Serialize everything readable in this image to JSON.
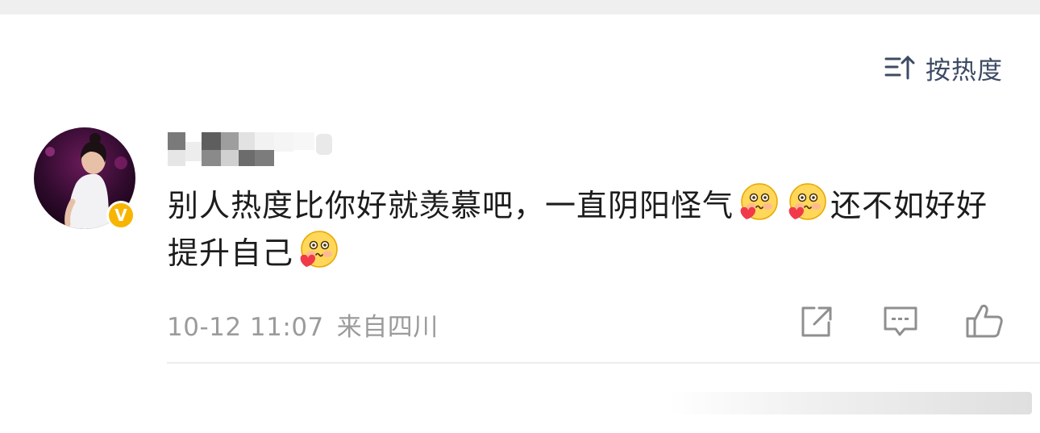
{
  "sort": {
    "label": "按热度"
  },
  "comment": {
    "text_part1": "别人热度比你好就羡慕吧，一直阴阳怪气",
    "text_part2": "还不如好好提升自己",
    "emoji_name": "shy-heart-emoji",
    "time": "10-12 11:07",
    "location": "来自四川"
  },
  "colors": {
    "sort_text": "#3d4b63",
    "meta_text": "#9b9b9b",
    "verified_badge": "#f7b500",
    "icon_stroke": "#8f8f8f"
  }
}
